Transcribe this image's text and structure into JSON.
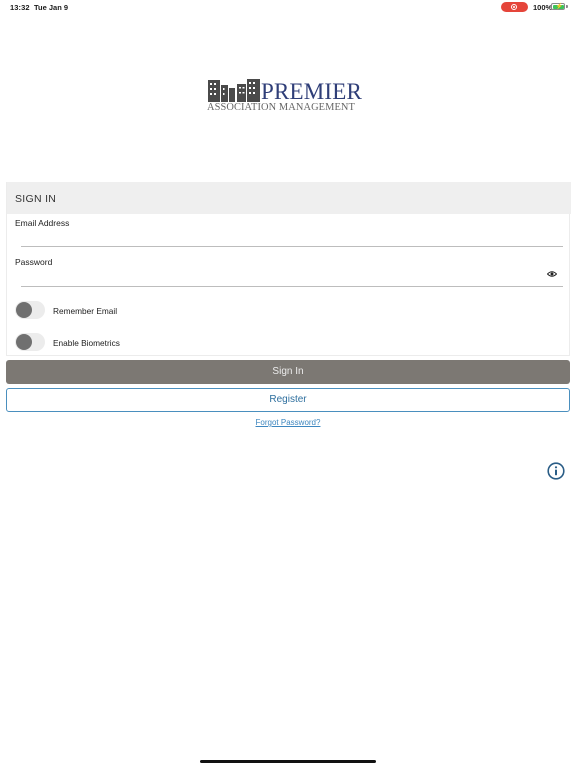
{
  "status_bar": {
    "time": "13:32",
    "date": "Tue Jan 9",
    "battery": "100%",
    "record_color": "#e5453a",
    "battery_color": "#3cc45b"
  },
  "logo": {
    "name": "PREMIER",
    "subtitle": "ASSOCIATION MANAGEMENT",
    "brand_color": "#2f3e78"
  },
  "signin": {
    "title": "SIGN IN",
    "email_label": "Email Address",
    "email_value": "",
    "password_label": "Password",
    "password_value": "",
    "remember_email_label": "Remember Email",
    "remember_email_on": false,
    "biometrics_label": "Enable Biometrics",
    "biometrics_on": false
  },
  "actions": {
    "signin_label": "Sign In",
    "register_label": "Register",
    "forgot_label": "Forgot Password?"
  },
  "icons": {
    "password_toggle": "eye-icon",
    "info": "info-icon",
    "record": "record-icon",
    "battery": "battery-icon"
  },
  "colors": {
    "signin_button": "#7c7873",
    "register_border": "#4a8fbe",
    "link": "#3d86bf",
    "info": "#2a5d86"
  }
}
